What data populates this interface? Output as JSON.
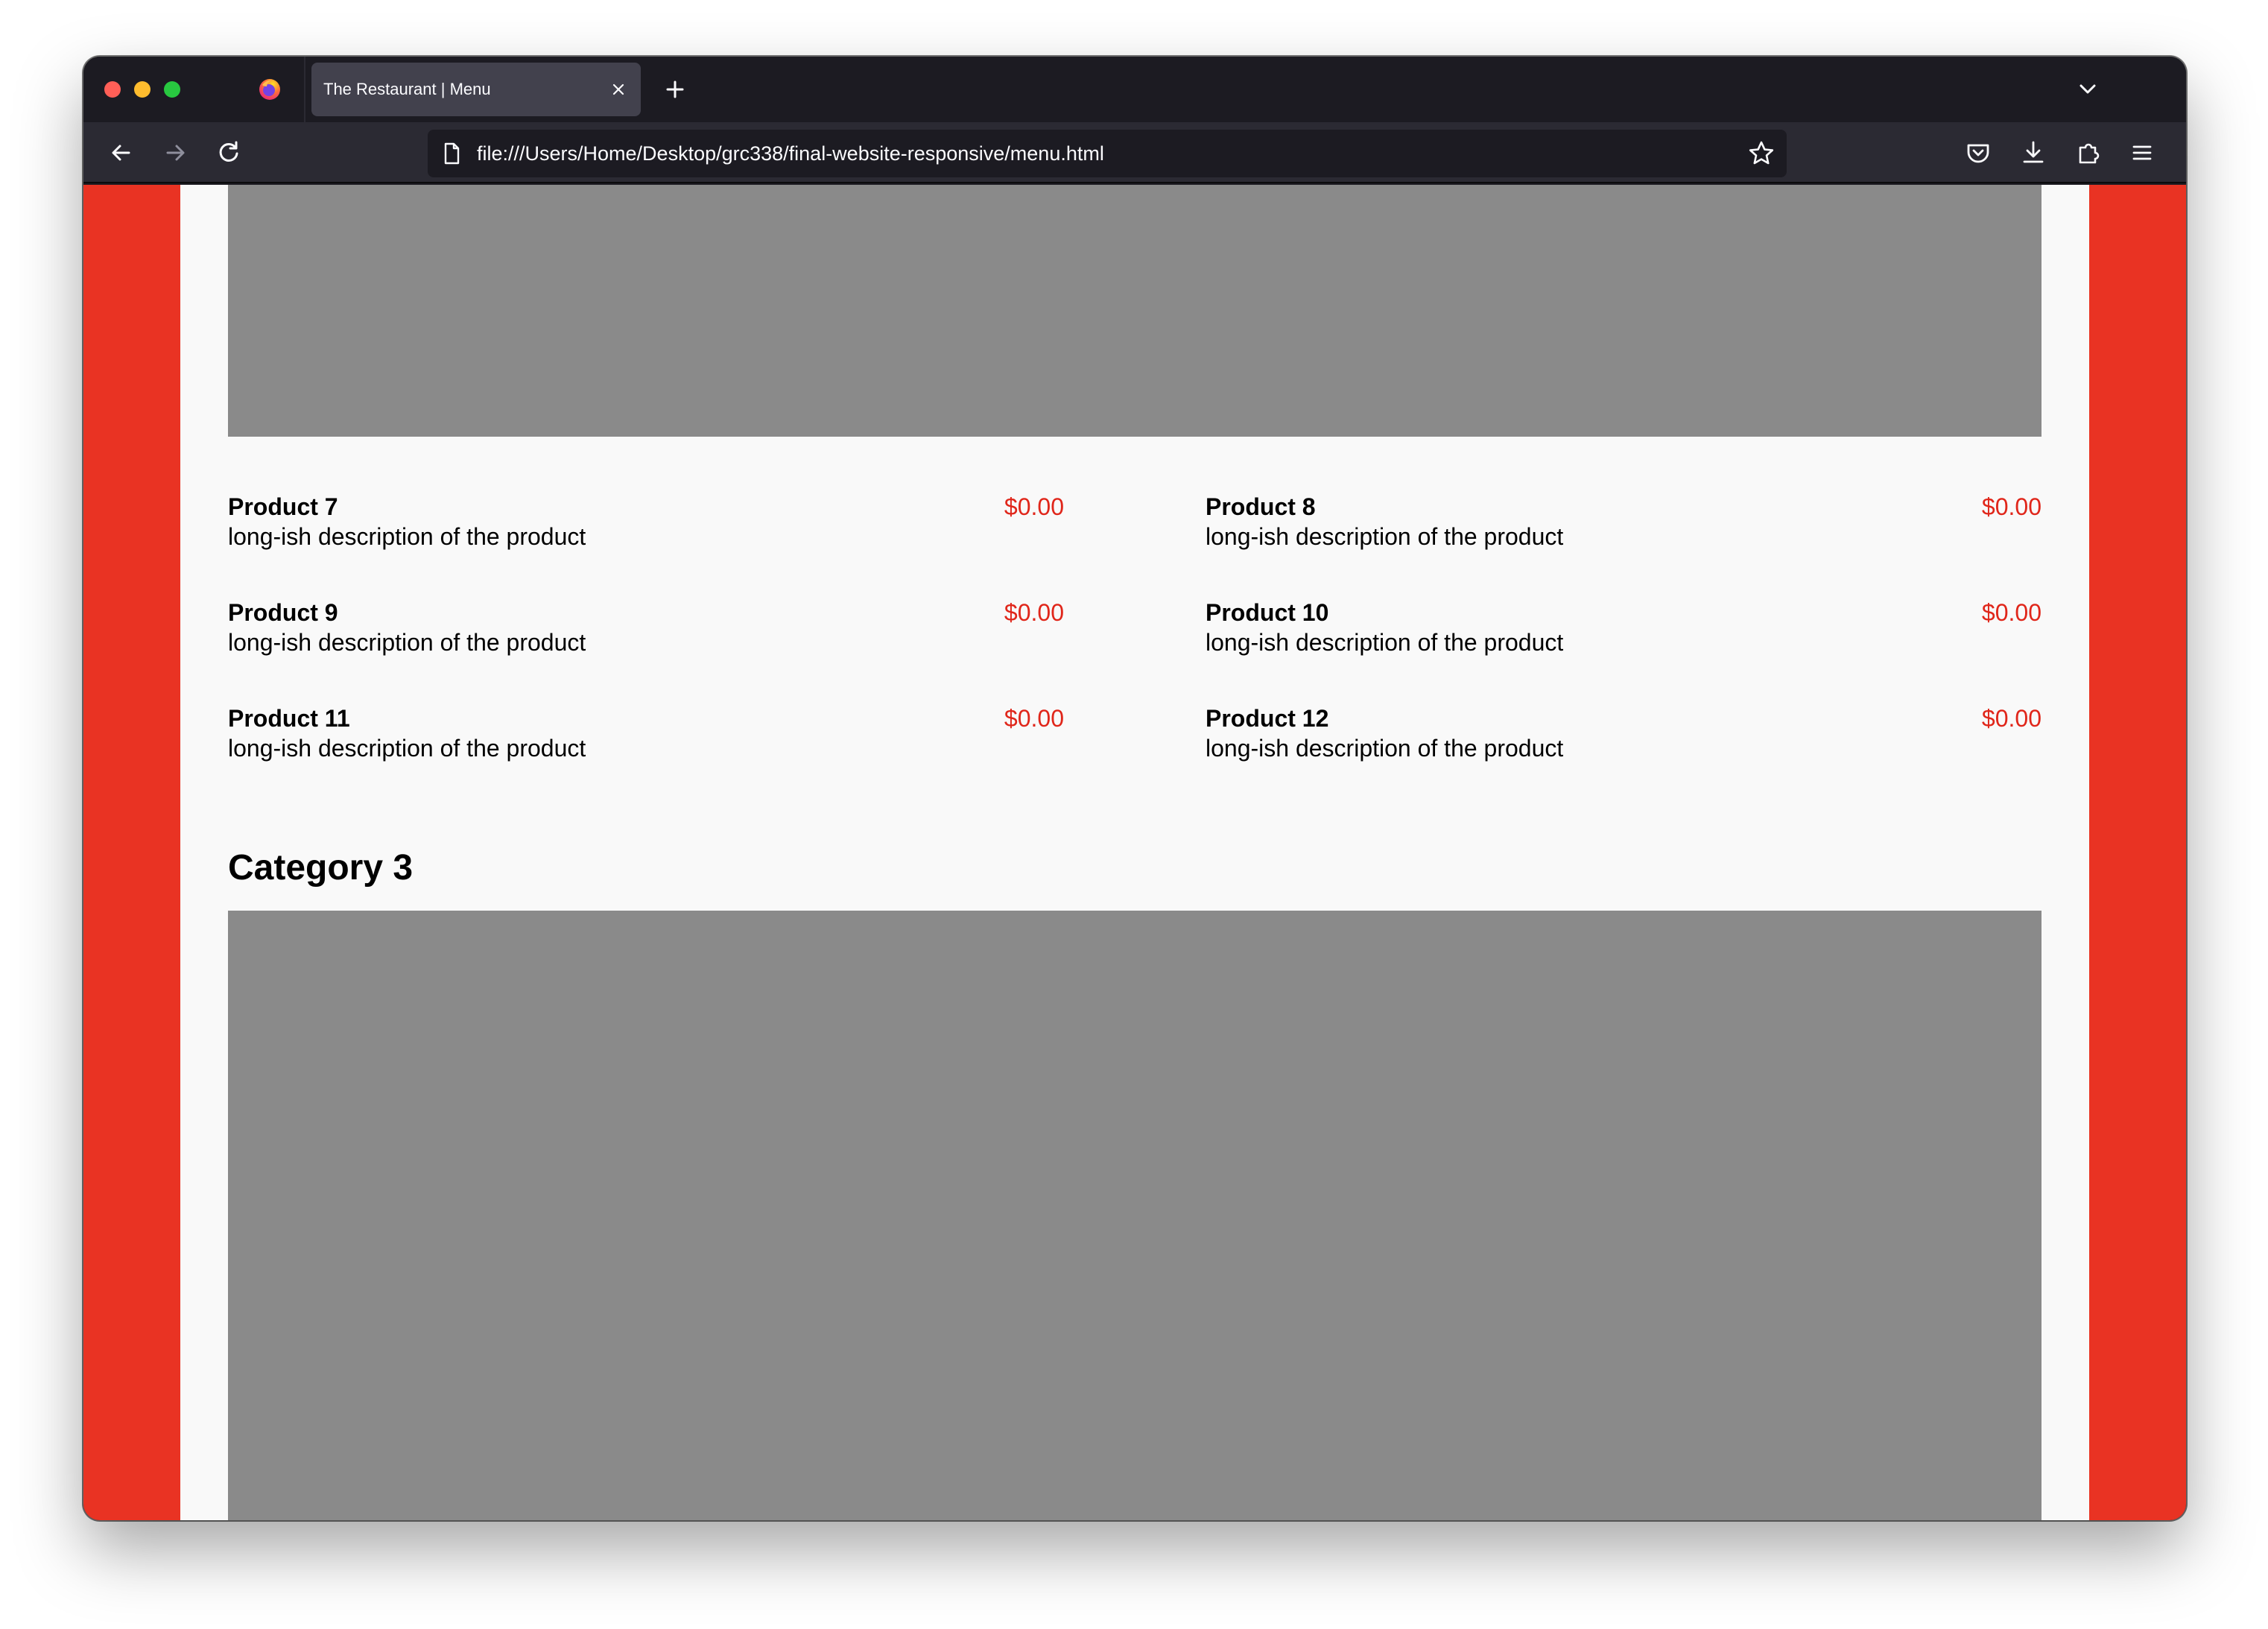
{
  "browser": {
    "tab": {
      "title": "The Restaurant | Menu"
    },
    "url": "file:///Users/Home/Desktop/grc338/final-website-responsive/menu.html",
    "icons": {
      "logo": "firefox-logo-icon",
      "close_tab": "close-icon",
      "new_tab": "plus-icon",
      "tab_list": "chevron-down-icon",
      "back": "arrow-left-icon",
      "forward": "arrow-right-icon",
      "reload": "reload-icon",
      "page": "page-icon",
      "bookmark": "star-icon",
      "pocket": "pocket-icon",
      "downloads": "download-icon",
      "extensions": "puzzle-icon",
      "menu": "hamburger-icon"
    }
  },
  "colors": {
    "page_border": "#e93323",
    "page_background": "#f9f9f9",
    "image_placeholder": "#8a8a8a",
    "price": "#e0261a"
  },
  "menu": {
    "products": [
      {
        "name": "Product 7",
        "description": "long-ish description of the product",
        "price": "$0.00"
      },
      {
        "name": "Product 8",
        "description": "long-ish description of the product",
        "price": "$0.00"
      },
      {
        "name": "Product 9",
        "description": "long-ish description of the product",
        "price": "$0.00"
      },
      {
        "name": "Product 10",
        "description": "long-ish description of the product",
        "price": "$0.00"
      },
      {
        "name": "Product 11",
        "description": "long-ish description of the product",
        "price": "$0.00"
      },
      {
        "name": "Product 12",
        "description": "long-ish description of the product",
        "price": "$0.00"
      }
    ],
    "next_category": {
      "title": "Category 3"
    }
  }
}
